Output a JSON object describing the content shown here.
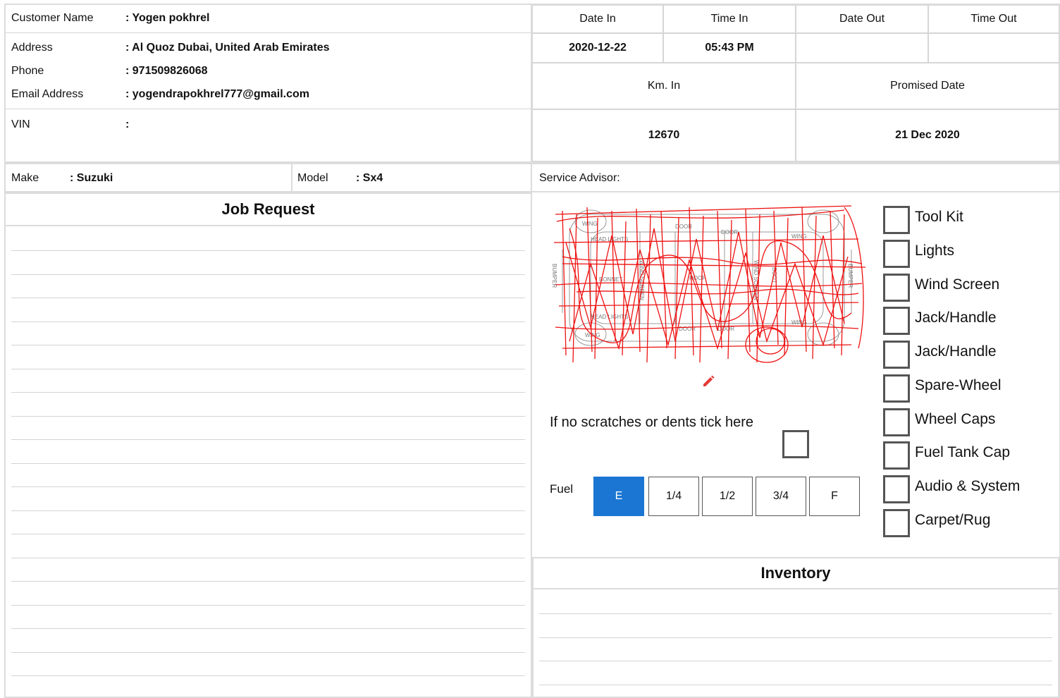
{
  "customer": {
    "name_label": "Customer Name",
    "name_value": ": Yogen pokhrel",
    "address_label": "Address",
    "address_value": ": Al Quoz Dubai, United Arab Emirates",
    "phone_label": "Phone",
    "phone_value": ": 971509826068",
    "email_label": "Email Address",
    "email_value": ": yogendrapokhrel777@gmail.com",
    "vin_label": "VIN",
    "vin_value": ":"
  },
  "dates": {
    "date_in_label": "Date In",
    "time_in_label": "Time In",
    "date_out_label": "Date Out",
    "time_out_label": "Time Out",
    "date_in": "2020-12-22",
    "time_in": "05:43 PM",
    "date_out": "",
    "time_out": "",
    "km_in_label": "Km. In",
    "promised_label": "Promised Date",
    "km_in": "12670",
    "promised_date": "21 Dec 2020"
  },
  "vehicle": {
    "make_label": "Make",
    "make_value": ": Suzuki",
    "model_label": "Model",
    "model_value": ": Sx4",
    "advisor_label": "Service Advisor:"
  },
  "job_request": {
    "title": "Job Request"
  },
  "diagram": {
    "labels": [
      "WING",
      "HEAD LIGHTS",
      "DOOR",
      "DOOR",
      "WING",
      "BUMPER",
      "BONNET",
      "WIND SCREEN",
      "ROOF",
      "WIND SCREEN",
      "BOOT",
      "BUMPER",
      "HEAD LIGHTS",
      "DOOR",
      "DOOR",
      "WING",
      "WING"
    ],
    "scribble_color": "#ee1111",
    "edit_icon": "pencil-icon",
    "no_damage_text": "If no scratches or dents tick here"
  },
  "fuel": {
    "label": "Fuel",
    "levels": [
      "E",
      "1/4",
      "1/2",
      "3/4",
      "F"
    ],
    "selected": "E",
    "accent": "#1a76d2"
  },
  "checklist": [
    "Tool Kit",
    "Lights",
    "Wind Screen",
    "Jack/Handle",
    "Jack/Handle",
    "Spare-Wheel",
    "Wheel Caps",
    "Fuel Tank Cap",
    "Audio & System",
    "Carpet/Rug"
  ],
  "inventory": {
    "title": "Inventory"
  }
}
